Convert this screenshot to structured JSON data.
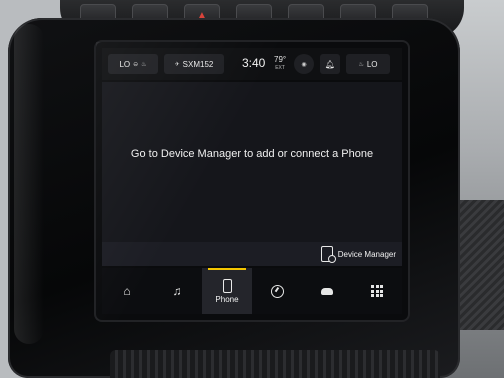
{
  "status_bar": {
    "fan_level": "LO",
    "radio_station": "SXM152",
    "clock": "3:40",
    "outside_temp": "79°",
    "outside_temp_label": "EXT",
    "right_seat_level": "LO"
  },
  "main": {
    "message": "Go to Device Manager to add or connect a Phone",
    "device_manager_label": "Device Manager"
  },
  "nav": {
    "home_icon": "home-icon",
    "media_icon": "music-note-icon",
    "phone_label": "Phone",
    "controls_icon": "gauge-icon",
    "vehicle_icon": "car-icon",
    "apps_icon": "grid-icon"
  },
  "colors": {
    "accent": "#f4c600",
    "screen_bg": "#15161b",
    "nav_bg": "#0c0d10"
  }
}
